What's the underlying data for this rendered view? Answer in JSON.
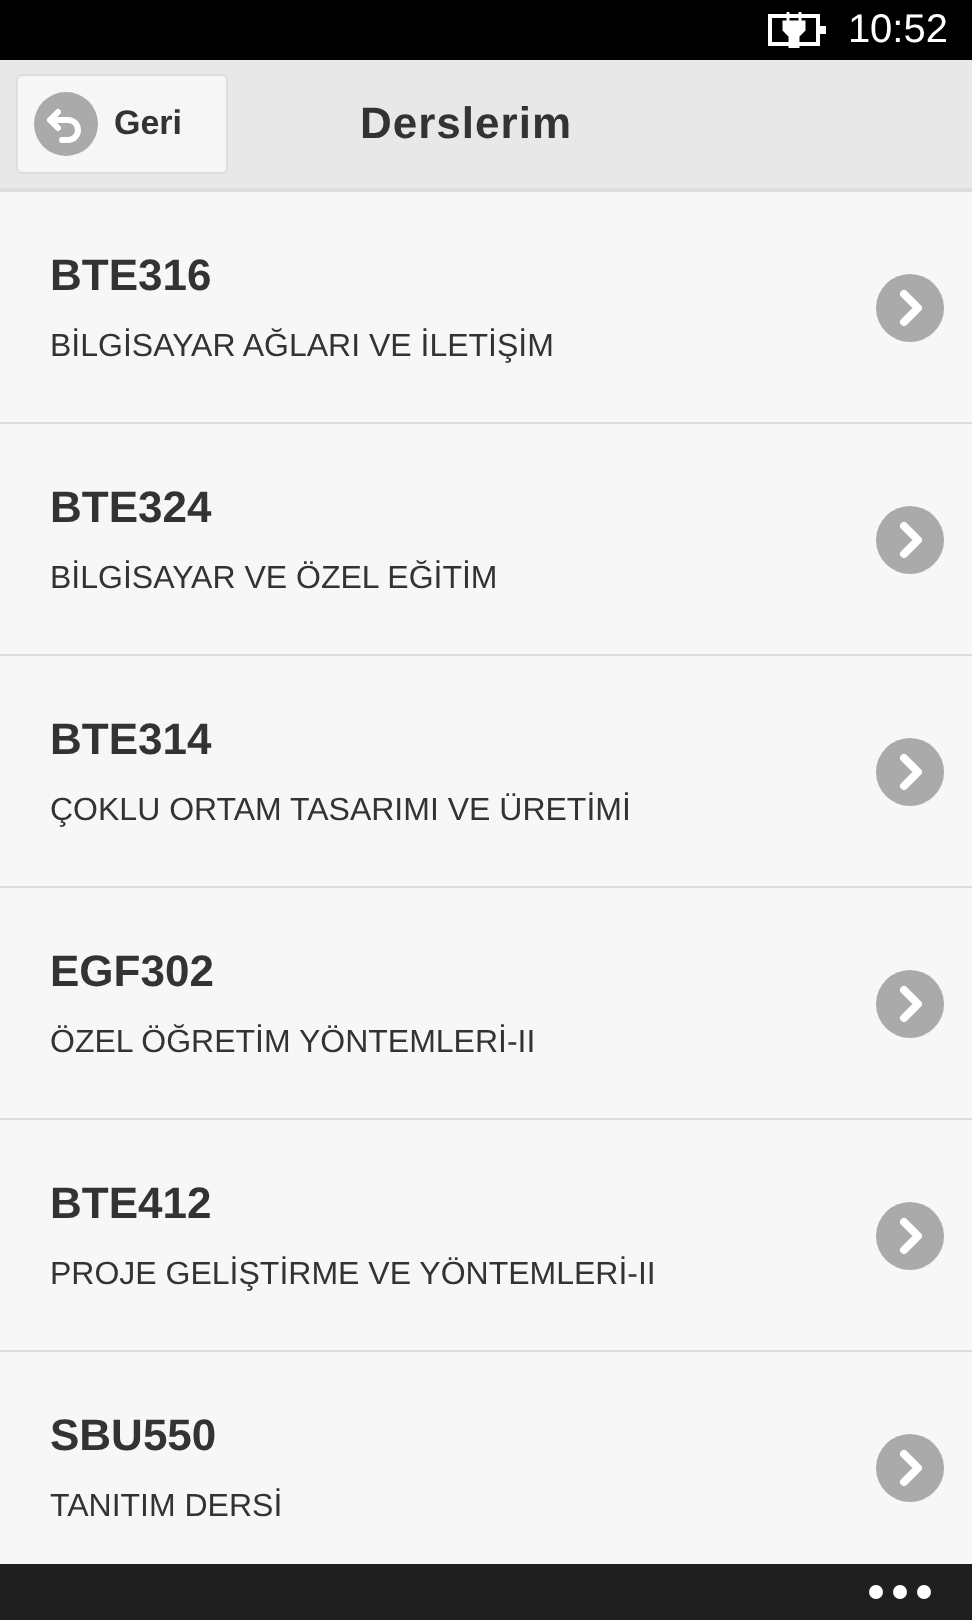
{
  "status_bar": {
    "time": "10:52"
  },
  "header": {
    "back_button": "Geri",
    "title": "Derslerim"
  },
  "courses": [
    {
      "code": "BTE316",
      "name": "BİLGİSAYAR AĞLARI VE İLETİŞİM"
    },
    {
      "code": "BTE324",
      "name": "BİLGİSAYAR VE ÖZEL EĞİTİM"
    },
    {
      "code": "BTE314",
      "name": "ÇOKLU ORTAM TASARIMI VE ÜRETİMİ"
    },
    {
      "code": "EGF302",
      "name": "ÖZEL ÖĞRETİM YÖNTEMLERİ-II"
    },
    {
      "code": "BTE412",
      "name": "PROJE GELİŞTİRME VE YÖNTEMLERİ-II"
    },
    {
      "code": "SBU550",
      "name": "TANITIM DERSİ"
    }
  ]
}
